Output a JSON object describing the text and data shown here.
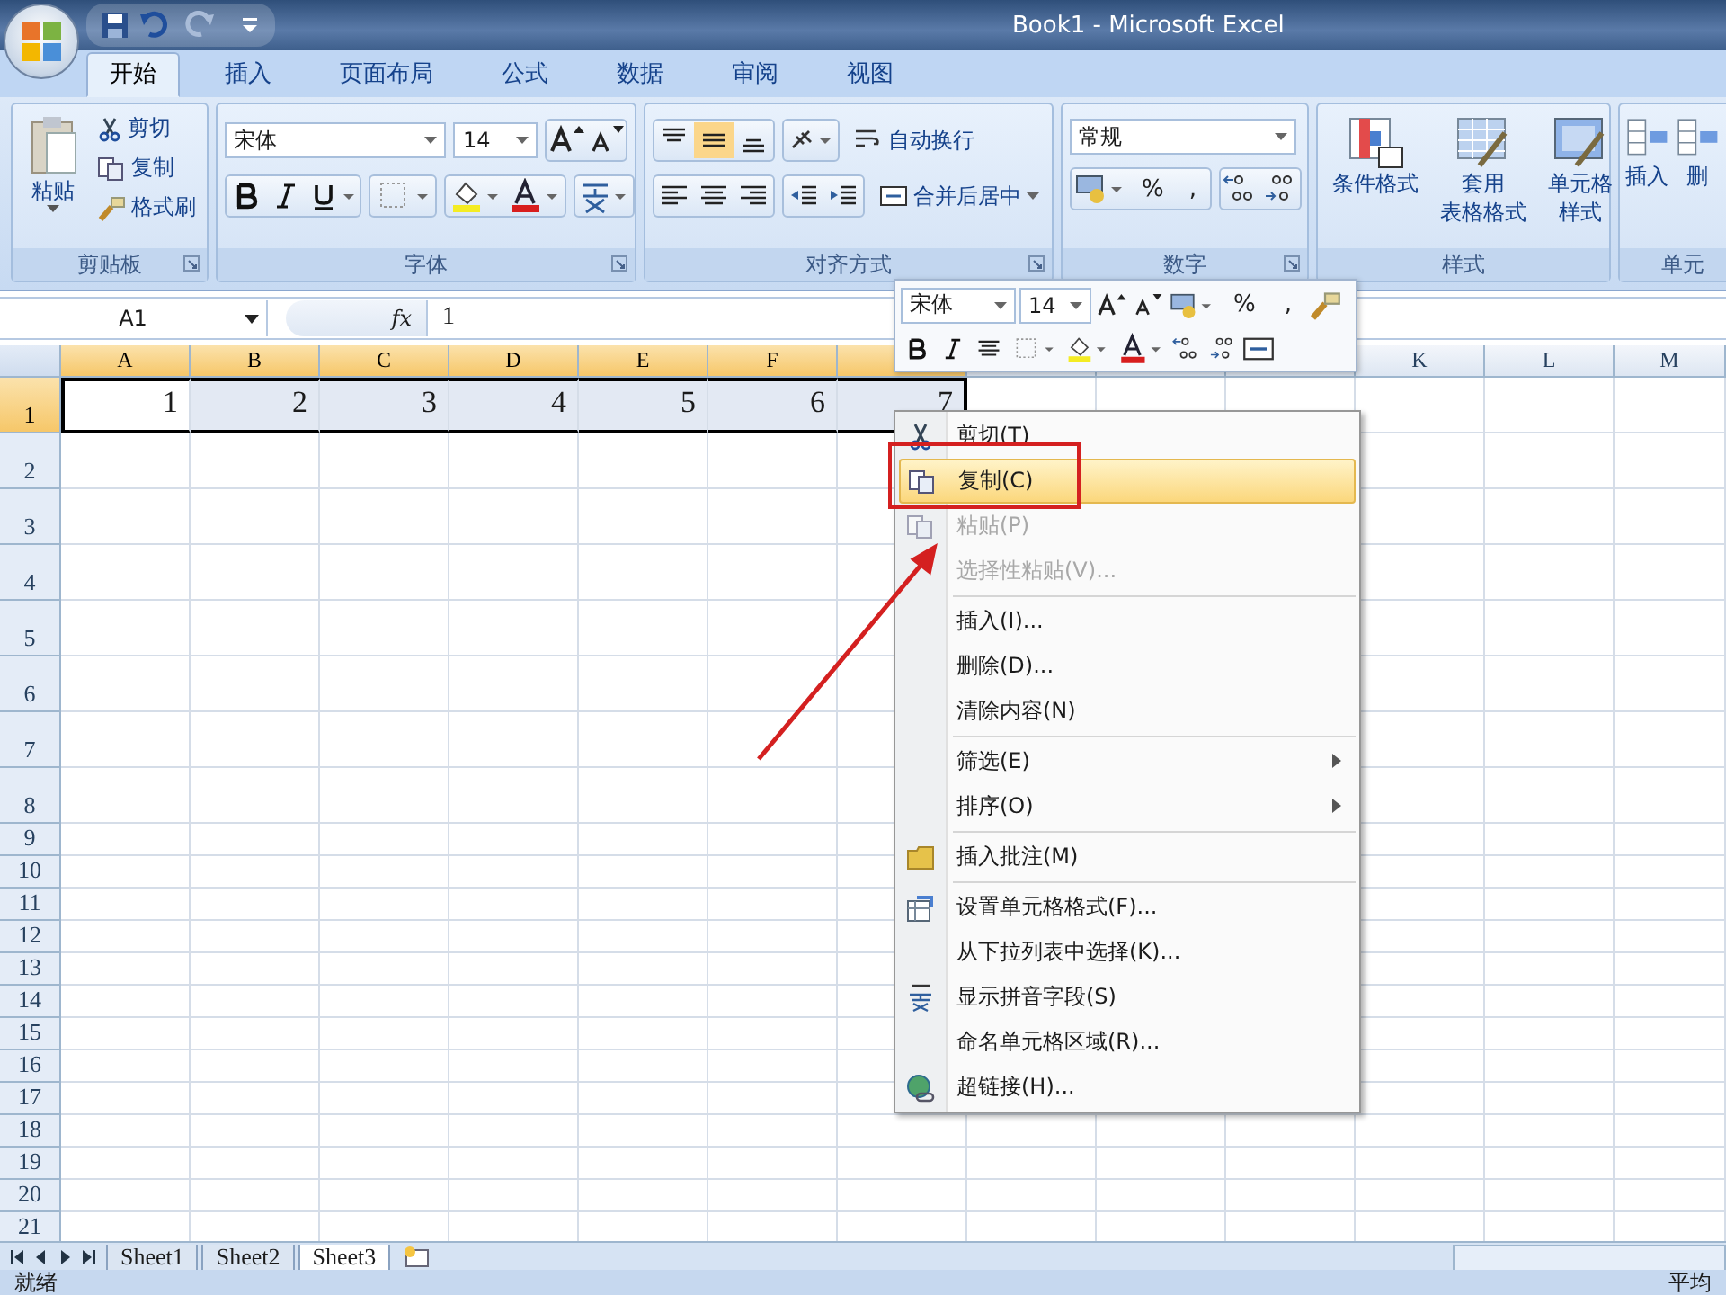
{
  "window": {
    "title": "Book1 - Microsoft Excel"
  },
  "ribbon_tabs": [
    {
      "label": "开始",
      "selected": true
    },
    {
      "label": "插入",
      "selected": false
    },
    {
      "label": "页面布局",
      "selected": false
    },
    {
      "label": "公式",
      "selected": false
    },
    {
      "label": "数据",
      "selected": false
    },
    {
      "label": "审阅",
      "selected": false
    },
    {
      "label": "视图",
      "selected": false
    }
  ],
  "clipboard": {
    "label": "剪贴板",
    "paste": "粘贴",
    "cut": "剪切",
    "copy": "复制",
    "format_painter": "格式刷"
  },
  "font": {
    "label": "字体",
    "font_name": "宋体",
    "font_size": "14"
  },
  "alignment": {
    "label": "对齐方式",
    "wrap_text": "自动换行",
    "merge_center": "合并后居中"
  },
  "number": {
    "label": "数字",
    "format": "常规",
    "percent": "%",
    "comma": ","
  },
  "styles": {
    "label": "样式",
    "buttons": [
      {
        "lines": [
          "条件格式"
        ]
      },
      {
        "lines": [
          "套用",
          "表格格式"
        ]
      },
      {
        "lines": [
          "单元格",
          "样式"
        ]
      }
    ]
  },
  "cells_group": {
    "label": "单元",
    "buttons": [
      {
        "lines": [
          "插入"
        ]
      },
      {
        "lines": [
          "删"
        ]
      }
    ]
  },
  "formula_bar": {
    "name_box": "A1",
    "fx": "fx",
    "value": "1"
  },
  "columns": [
    {
      "label": "A",
      "selected": true
    },
    {
      "label": "B",
      "selected": true
    },
    {
      "label": "C",
      "selected": true
    },
    {
      "label": "D",
      "selected": true
    },
    {
      "label": "E",
      "selected": true
    },
    {
      "label": "F",
      "selected": true
    },
    {
      "selected": true
    },
    {
      "selected": false
    },
    {
      "selected": false
    },
    {
      "selected": false
    },
    {
      "label": "K",
      "selected": false
    },
    {
      "label": "L",
      "selected": false
    },
    {
      "label": "M",
      "selected": false
    }
  ],
  "rows": [
    {
      "header": "1",
      "selected": true,
      "cells": [
        {
          "value": "1",
          "selected": true,
          "active": true
        },
        {
          "value": "2",
          "selected": true,
          "active": false
        },
        {
          "value": "3",
          "selected": true,
          "active": false
        },
        {
          "value": "4",
          "selected": true,
          "active": false
        },
        {
          "value": "5",
          "selected": true,
          "active": false
        },
        {
          "value": "6",
          "selected": true,
          "active": false
        },
        {
          "value": "7",
          "selected": true,
          "active": false
        }
      ]
    },
    {
      "header": "2",
      "selected": false
    },
    {
      "header": "3",
      "selected": false
    },
    {
      "header": "4",
      "selected": false
    },
    {
      "header": "5",
      "selected": false
    },
    {
      "header": "6",
      "selected": false
    },
    {
      "header": "7",
      "selected": false
    },
    {
      "header": "8",
      "selected": false
    },
    {
      "header": "9",
      "selected": false
    },
    {
      "header": "10",
      "selected": false
    },
    {
      "header": "11",
      "selected": false
    },
    {
      "header": "12",
      "selected": false
    },
    {
      "header": "13",
      "selected": false
    },
    {
      "header": "14",
      "selected": false
    },
    {
      "header": "15",
      "selected": false
    },
    {
      "header": "16",
      "selected": false
    },
    {
      "header": "17",
      "selected": false
    },
    {
      "header": "18",
      "selected": false
    },
    {
      "header": "19",
      "selected": false
    },
    {
      "header": "20",
      "selected": false
    },
    {
      "header": "21",
      "selected": false
    }
  ],
  "mini_toolbar": {
    "font_name": "宋体",
    "font_size": "14",
    "percent": "%",
    "comma": ","
  },
  "context_menu": {
    "sections": [
      [
        {
          "label": "剪切(T)",
          "kind": "cut",
          "disabled": false,
          "selected": false,
          "submenu": false
        },
        {
          "label": "复制(C)",
          "kind": "copy",
          "disabled": false,
          "selected": true,
          "submenu": false
        },
        {
          "label": "粘贴(P)",
          "kind": "paste",
          "disabled": true,
          "selected": false,
          "submenu": false
        },
        {
          "label": "选择性粘贴(V)...",
          "kind": "plain",
          "disabled": true,
          "selected": false,
          "submenu": false
        }
      ],
      [
        {
          "label": "插入(I)...",
          "kind": "plain",
          "disabled": false,
          "selected": false,
          "submenu": false
        },
        {
          "label": "删除(D)...",
          "kind": "plain",
          "disabled": false,
          "selected": false,
          "submenu": false
        },
        {
          "label": "清除内容(N)",
          "kind": "plain",
          "disabled": false,
          "selected": false,
          "submenu": false
        }
      ],
      [
        {
          "label": "筛选(E)",
          "kind": "plain",
          "disabled": false,
          "selected": false,
          "submenu": true
        },
        {
          "label": "排序(O)",
          "kind": "plain",
          "disabled": false,
          "selected": false,
          "submenu": true
        }
      ],
      [
        {
          "label": "插入批注(M)",
          "kind": "comment",
          "disabled": false,
          "selected": false,
          "submenu": false
        }
      ],
      [
        {
          "label": "设置单元格格式(F)...",
          "kind": "format",
          "disabled": false,
          "selected": false,
          "submenu": false
        },
        {
          "label": "从下拉列表中选择(K)...",
          "kind": "plain",
          "disabled": false,
          "selected": false,
          "submenu": false
        },
        {
          "label": "显示拼音字段(S)",
          "kind": "phonetic",
          "disabled": false,
          "selected": false,
          "submenu": false
        },
        {
          "label": "命名单元格区域(R)...",
          "kind": "plain",
          "disabled": false,
          "selected": false,
          "submenu": false
        },
        {
          "label": "超链接(H)...",
          "kind": "link",
          "disabled": false,
          "selected": false,
          "submenu": false
        }
      ]
    ]
  },
  "sheet_tabs": [
    {
      "label": "Sheet1",
      "selected": false
    },
    {
      "label": "Sheet2",
      "selected": false
    },
    {
      "label": "Sheet3",
      "selected": true
    }
  ],
  "status_bar": {
    "left": "就绪",
    "right": "平均"
  }
}
